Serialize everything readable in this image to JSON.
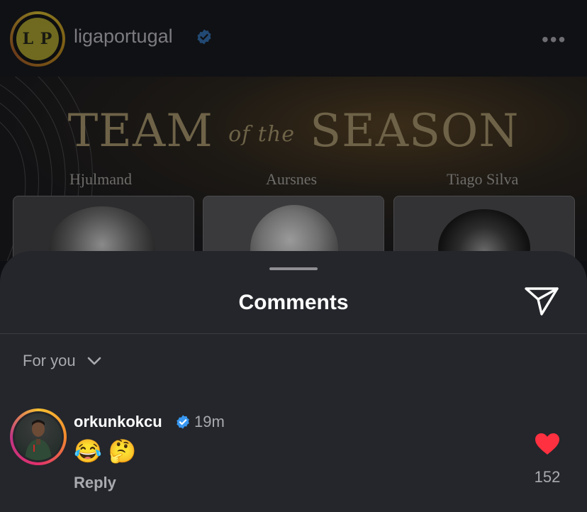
{
  "post": {
    "username": "ligaportugal",
    "logo_text": "L P",
    "more_glyph": "•••"
  },
  "banner": {
    "title_left": "TEAM",
    "title_mid": "of the",
    "title_right": "SEASON",
    "players": [
      "Hjulmand",
      "Aursnes",
      "Tiago Silva"
    ]
  },
  "comments_sheet": {
    "title": "Comments",
    "filter_label": "For you",
    "comment": {
      "username": "orkunkokcu",
      "time": "19m",
      "text": "😂 🤔",
      "reply_label": "Reply",
      "like_count": "152"
    }
  },
  "colors": {
    "verified": "#3897f0",
    "heart": "#ff3040",
    "sheet_bg": "#24262b"
  },
  "icons": [
    "verified-badge-icon",
    "more-icon",
    "share-icon",
    "chevron-down-icon",
    "heart-icon"
  ]
}
